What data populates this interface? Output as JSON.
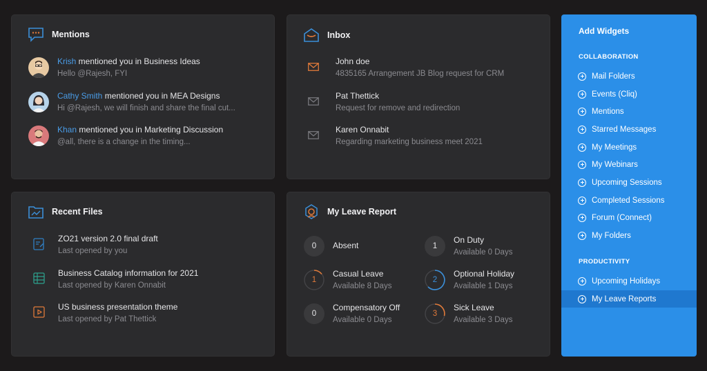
{
  "mentions": {
    "title": "Mentions",
    "items": [
      {
        "name": "Krish",
        "text": " mentioned you in Business Ideas",
        "preview": "Hello @Rajesh, FYI",
        "avatar_color": "#e7c9a2"
      },
      {
        "name": "Cathy Smith",
        "text": " mentioned you in MEA Designs",
        "preview": "Hi @Rajesh, we will finish and share the final cut...",
        "avatar_color": "#b6d3ea"
      },
      {
        "name": "Khan",
        "text": " mentioned you in Marketing Discussion",
        "preview": "@all, there is a change in the timing...",
        "avatar_color": "#d9797b"
      }
    ]
  },
  "inbox": {
    "title": "Inbox",
    "items": [
      {
        "sender": "John doe",
        "subject": "4835165 Arrangement JB Blog request for CRM"
      },
      {
        "sender": "Pat Thettick",
        "subject": "Request for remove and redirection"
      },
      {
        "sender": "Karen Onnabit",
        "subject": "Regarding marketing business meet 2021"
      }
    ]
  },
  "recent_files": {
    "title": "Recent Files",
    "items": [
      {
        "name": "ZO21 version 2.0 final draft",
        "meta": "Last opened by you"
      },
      {
        "name": "Business Catalog information for 2021",
        "meta": "Last opened by Karen Onnabit"
      },
      {
        "name": "US business presentation theme",
        "meta": "Last opened by Pat Thettick"
      }
    ]
  },
  "leave_report": {
    "title": "My Leave Report",
    "items": [
      {
        "type": "Absent",
        "count": "0",
        "available": ""
      },
      {
        "type": "On Duty",
        "count": "1",
        "available": "Available 0 Days"
      },
      {
        "type": "Casual Leave",
        "count": "1",
        "available": "Available 8 Days",
        "color": "#e07a3a"
      },
      {
        "type": "Optional Holiday",
        "count": "2",
        "available": "Available 1 Days",
        "color": "#3b8fd9"
      },
      {
        "type": "Compensatory Off",
        "count": "0",
        "available": "Available 0 Days"
      },
      {
        "type": "Sick Leave",
        "count": "3",
        "available": "Available 3 Days",
        "color": "#e07a3a"
      }
    ]
  },
  "add_widgets": {
    "title": "Add Widgets",
    "collaboration_label": "COLLABORATION",
    "collaboration": [
      "Mail Folders",
      "Events (Cliq)",
      "Mentions",
      "Starred Messages",
      "My Meetings",
      "My Webinars",
      "Upcoming Sessions",
      "Completed Sessions",
      "Forum (Connect)",
      "My Folders"
    ],
    "productivity_label": "PRODUCTIVITY",
    "productivity": [
      "Upcoming Holidays",
      "My Leave Reports"
    ],
    "active_item": "My Leave Reports"
  },
  "colors": {
    "background": "#1c1a1b",
    "card": "#2b2b2d",
    "accent_blue": "#2b8fe8",
    "link": "#4a9de8",
    "orange": "#e07a3a"
  }
}
